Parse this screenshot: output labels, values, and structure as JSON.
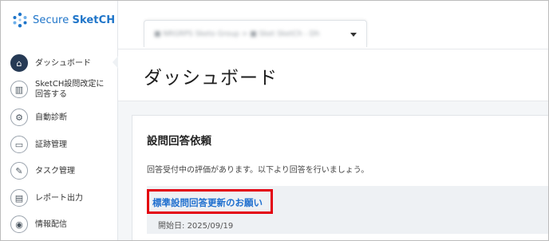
{
  "brand": {
    "name_light": "Secure ",
    "name_bold": "SketCH",
    "logo_icon": "hexagon-dots-logo"
  },
  "sidebar": {
    "items": [
      {
        "label": "ダッシュボード",
        "icon": "home-icon",
        "glyph": "⌂",
        "active": true
      },
      {
        "label_line1": "SketCH設問改定に",
        "label_line2": "回答する",
        "icon": "bar-chart-icon",
        "glyph": "▥"
      },
      {
        "label": "自動診断",
        "icon": "gear-icon",
        "glyph": "⚙"
      },
      {
        "label": "証跡管理",
        "icon": "folder-icon",
        "glyph": "▭"
      },
      {
        "label": "タスク管理",
        "icon": "clipboard-icon",
        "glyph": "✎"
      },
      {
        "label": "レポート出力",
        "icon": "document-icon",
        "glyph": "▤"
      },
      {
        "label": "情報配信",
        "icon": "broadcast-icon",
        "glyph": "◉"
      }
    ]
  },
  "header": {
    "org_selector_text": "■ NRGRPS Sketo Group  >  ■ Sket SketCh - Dh"
  },
  "page": {
    "title": "ダッシュボード"
  },
  "card": {
    "title": "設問回答依頼",
    "description": "回答受付中の評価があります。以下より回答を行いましょう。",
    "request": {
      "link_text": "標準設問回答更新のお願い",
      "start_label": "開始日: ",
      "start_date": "2025/09/19"
    }
  },
  "colors": {
    "accent": "#1f75c9",
    "active_nav": "#263a55",
    "highlight_box": "#e3000f",
    "link": "#1f6fcf"
  }
}
